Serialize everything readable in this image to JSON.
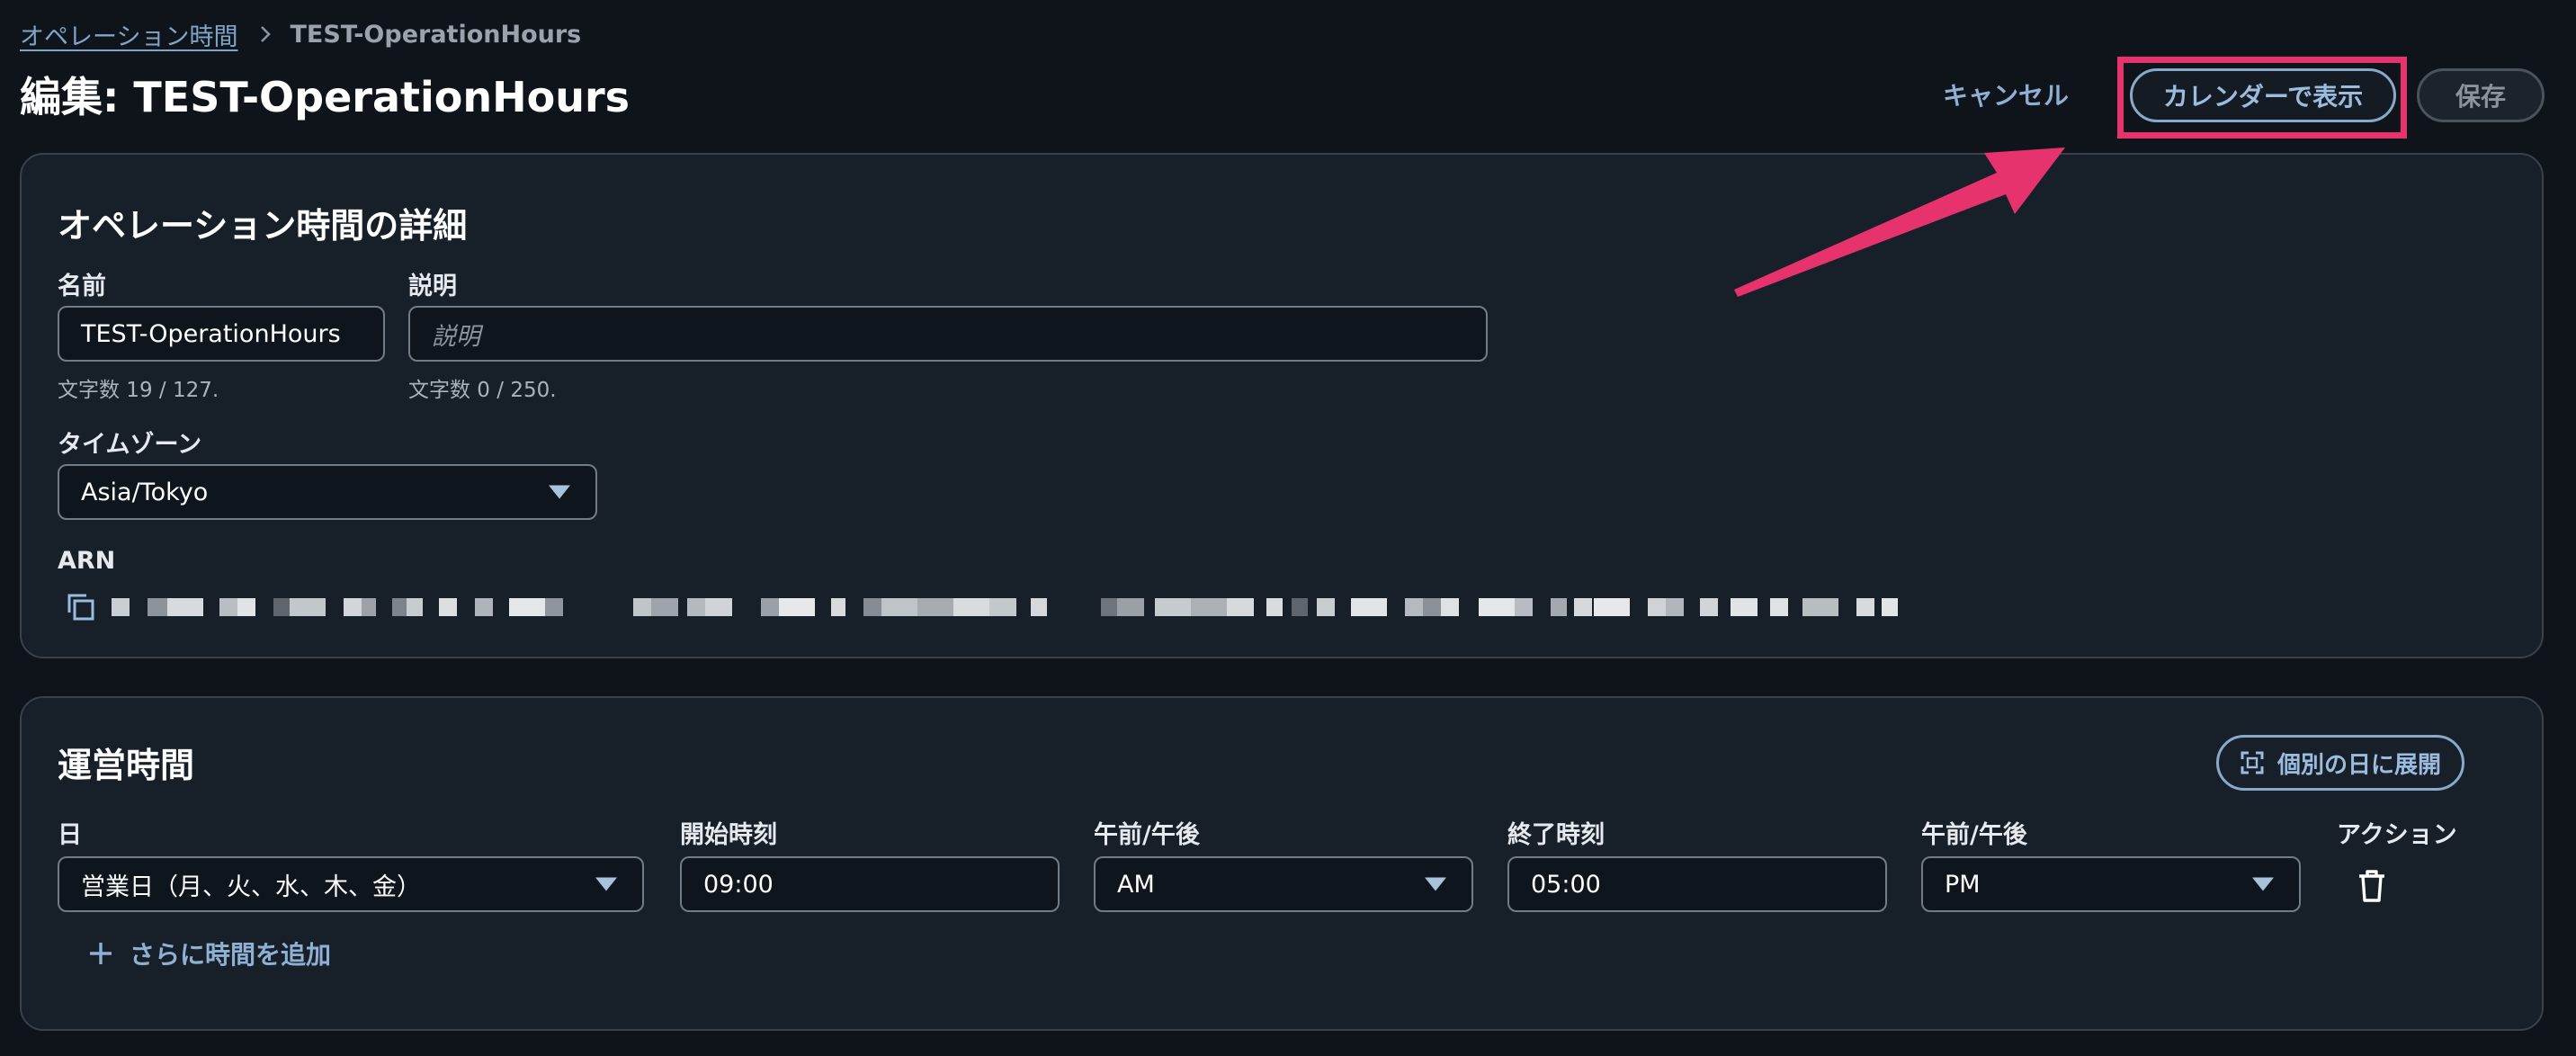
{
  "breadcrumb": {
    "parent": "オペレーション時間",
    "current": "TEST-OperationHours"
  },
  "page_title": "編集: TEST-OperationHours",
  "header_actions": {
    "cancel": "キャンセル",
    "view_calendar": "カレンダーで表示",
    "save": "保存"
  },
  "details": {
    "heading": "オペレーション時間の詳細",
    "name_label": "名前",
    "name_value": "TEST-OperationHours",
    "name_count": "文字数 19 / 127.",
    "description_label": "説明",
    "description_placeholder": "説明",
    "description_count": "文字数 0 / 250.",
    "timezone_label": "タイムゾーン",
    "timezone_value": "Asia/Tokyo",
    "arn_label": "ARN"
  },
  "hours": {
    "heading": "運営時間",
    "expand_button": "個別の日に展開",
    "columns": {
      "day": "日",
      "start_time": "開始時刻",
      "start_ampm": "午前/午後",
      "end_time": "終了時刻",
      "end_ampm": "午前/午後",
      "action": "アクション"
    },
    "row": {
      "day": "営業日（月、火、水、木、金）",
      "start_time": "09:00",
      "start_ampm": "AM",
      "end_time": "05:00",
      "end_ampm": "PM"
    },
    "add_more": "さらに時間を追加"
  },
  "colors": {
    "background": "#0f141a",
    "panel": "#171f29",
    "accent": "#89a9cb",
    "highlight": "#e6336e"
  }
}
